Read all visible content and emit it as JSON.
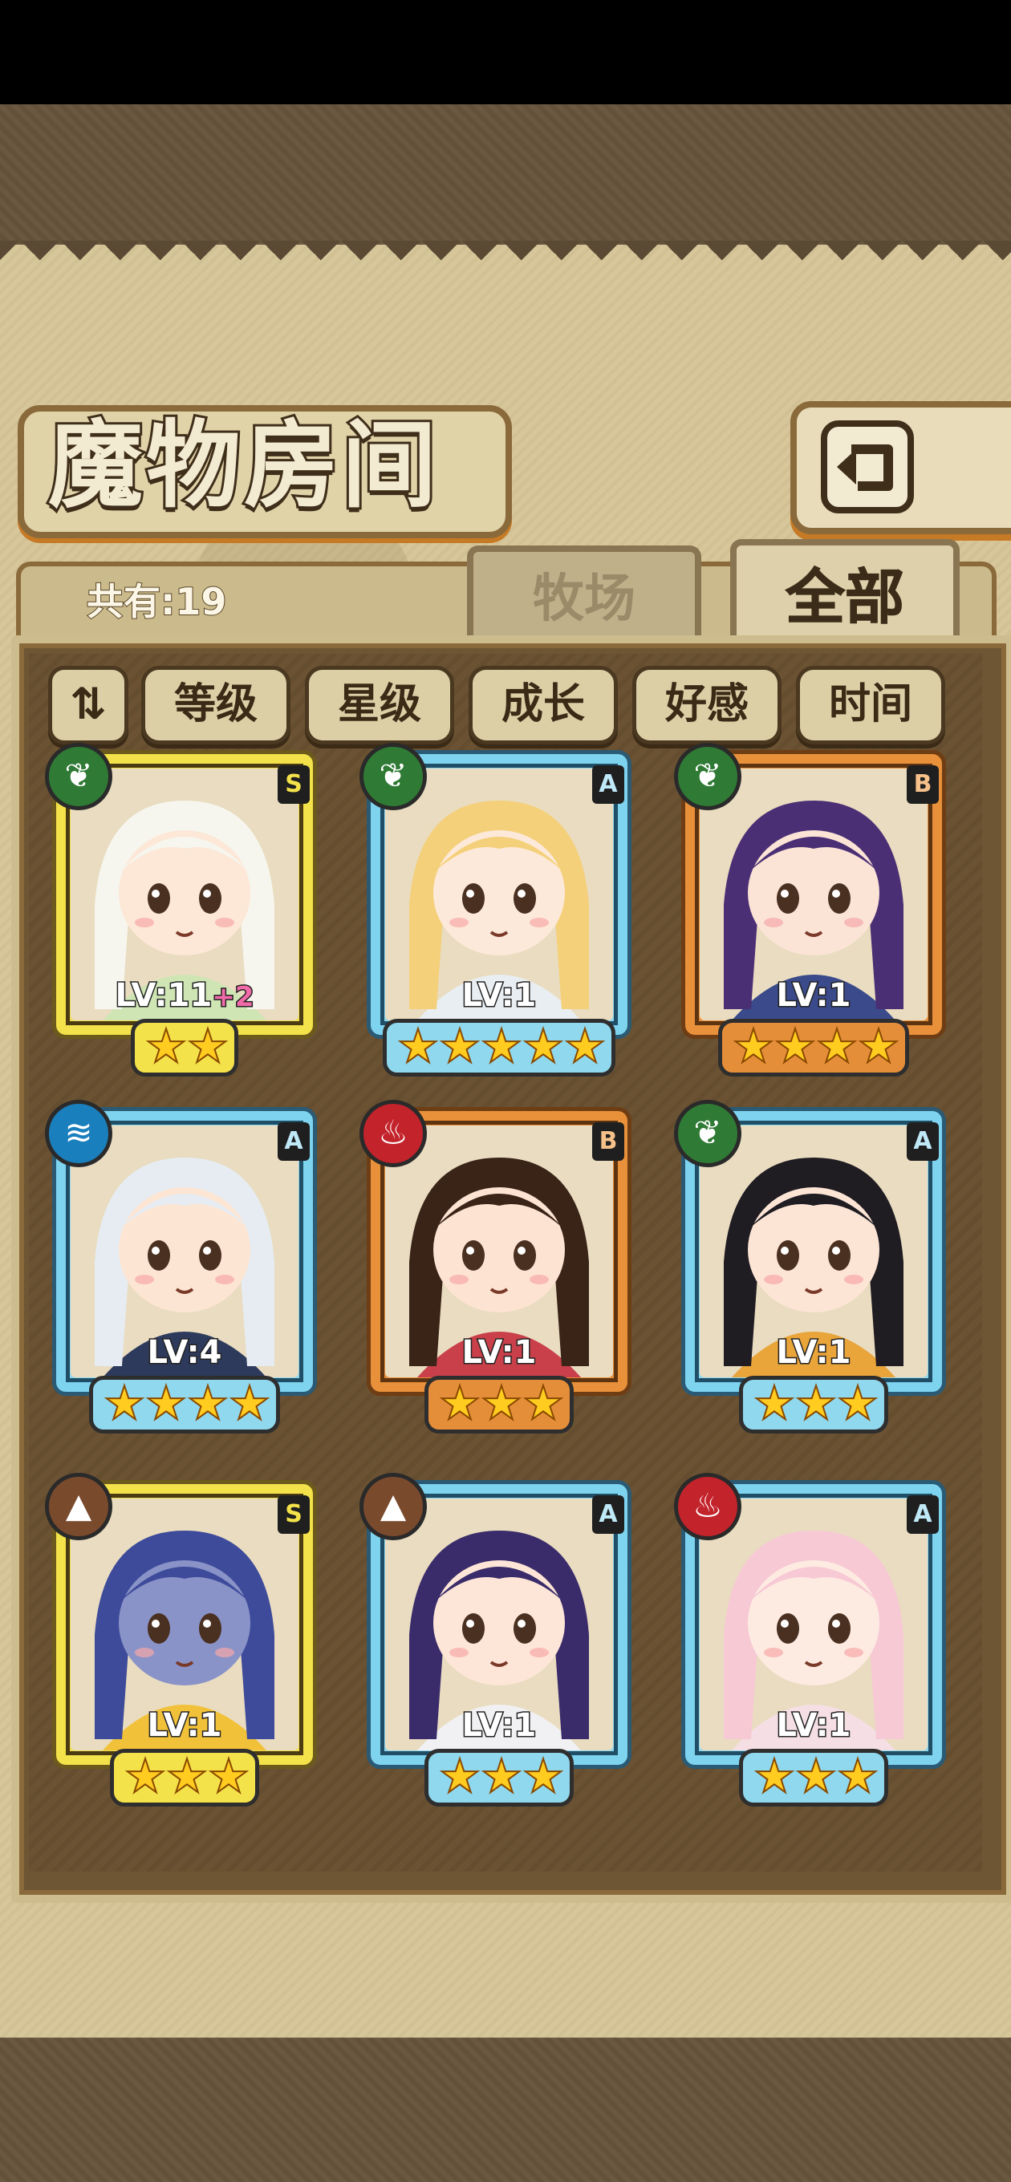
{
  "page_title": "魔物房间",
  "count_text": "共有:19",
  "tabs": [
    {
      "label": "牧场",
      "active": false
    },
    {
      "label": "全部",
      "active": true
    }
  ],
  "sort_toggle_label": "⇅",
  "filters": [
    "等级",
    "星级",
    "成长",
    "好感",
    "时间"
  ],
  "monsters": [
    {
      "level": "LV:11",
      "bonus": "+2",
      "rank": "S",
      "element": "leaf",
      "element_icon": "leaf-icon",
      "stars": 2,
      "hair": "#f6f6ee",
      "skin": "#fde7d6",
      "outfit": "#cfe5b4"
    },
    {
      "level": "LV:1",
      "bonus": "",
      "rank": "A",
      "element": "leaf",
      "element_icon": "leaf-icon",
      "stars": 5,
      "hair": "#f4d07a",
      "skin": "#fde9d9",
      "outfit": "#e9eef2"
    },
    {
      "level": "LV:1",
      "bonus": "",
      "rank": "B",
      "element": "leaf",
      "element_icon": "leaf-icon",
      "stars": 4,
      "hair": "#4a2f74",
      "skin": "#fbe4d6",
      "outfit": "#3a4a8a"
    },
    {
      "level": "LV:4",
      "bonus": "",
      "rank": "A",
      "element": "water",
      "element_icon": "water-icon",
      "stars": 4,
      "hair": "#e6ecf2",
      "skin": "#fde5d3",
      "outfit": "#2d3a5c"
    },
    {
      "level": "LV:1",
      "bonus": "",
      "rank": "B",
      "element": "fire",
      "element_icon": "fire-icon",
      "stars": 3,
      "hair": "#3a2418",
      "skin": "#fde3d2",
      "outfit": "#c9404a"
    },
    {
      "level": "LV:1",
      "bonus": "",
      "rank": "A",
      "element": "leaf",
      "element_icon": "leaf-icon",
      "stars": 3,
      "hair": "#1f1c22",
      "skin": "#fde5d6",
      "outfit": "#e9a43a"
    },
    {
      "level": "LV:1",
      "bonus": "",
      "rank": "S",
      "element": "earth",
      "element_icon": "mountain-icon",
      "stars": 3,
      "hair": "#3d4b9a",
      "skin": "#8a93c8",
      "outfit": "#f2c13a"
    },
    {
      "level": "LV:1",
      "bonus": "",
      "rank": "A",
      "element": "earth",
      "element_icon": "mountain-icon",
      "stars": 3,
      "hair": "#3a2c6a",
      "skin": "#fde6d7",
      "outfit": "#f1f1f4"
    },
    {
      "level": "LV:1",
      "bonus": "",
      "rank": "A",
      "element": "fire",
      "element_icon": "fire-icon",
      "stars": 3,
      "hair": "#f7c9d4",
      "skin": "#fdebe2",
      "outfit": "#f5dfe4"
    }
  ],
  "colors": {
    "parchment": "#d6c69a",
    "panel": "#6e5533",
    "accent_orange": "#c67a25"
  }
}
